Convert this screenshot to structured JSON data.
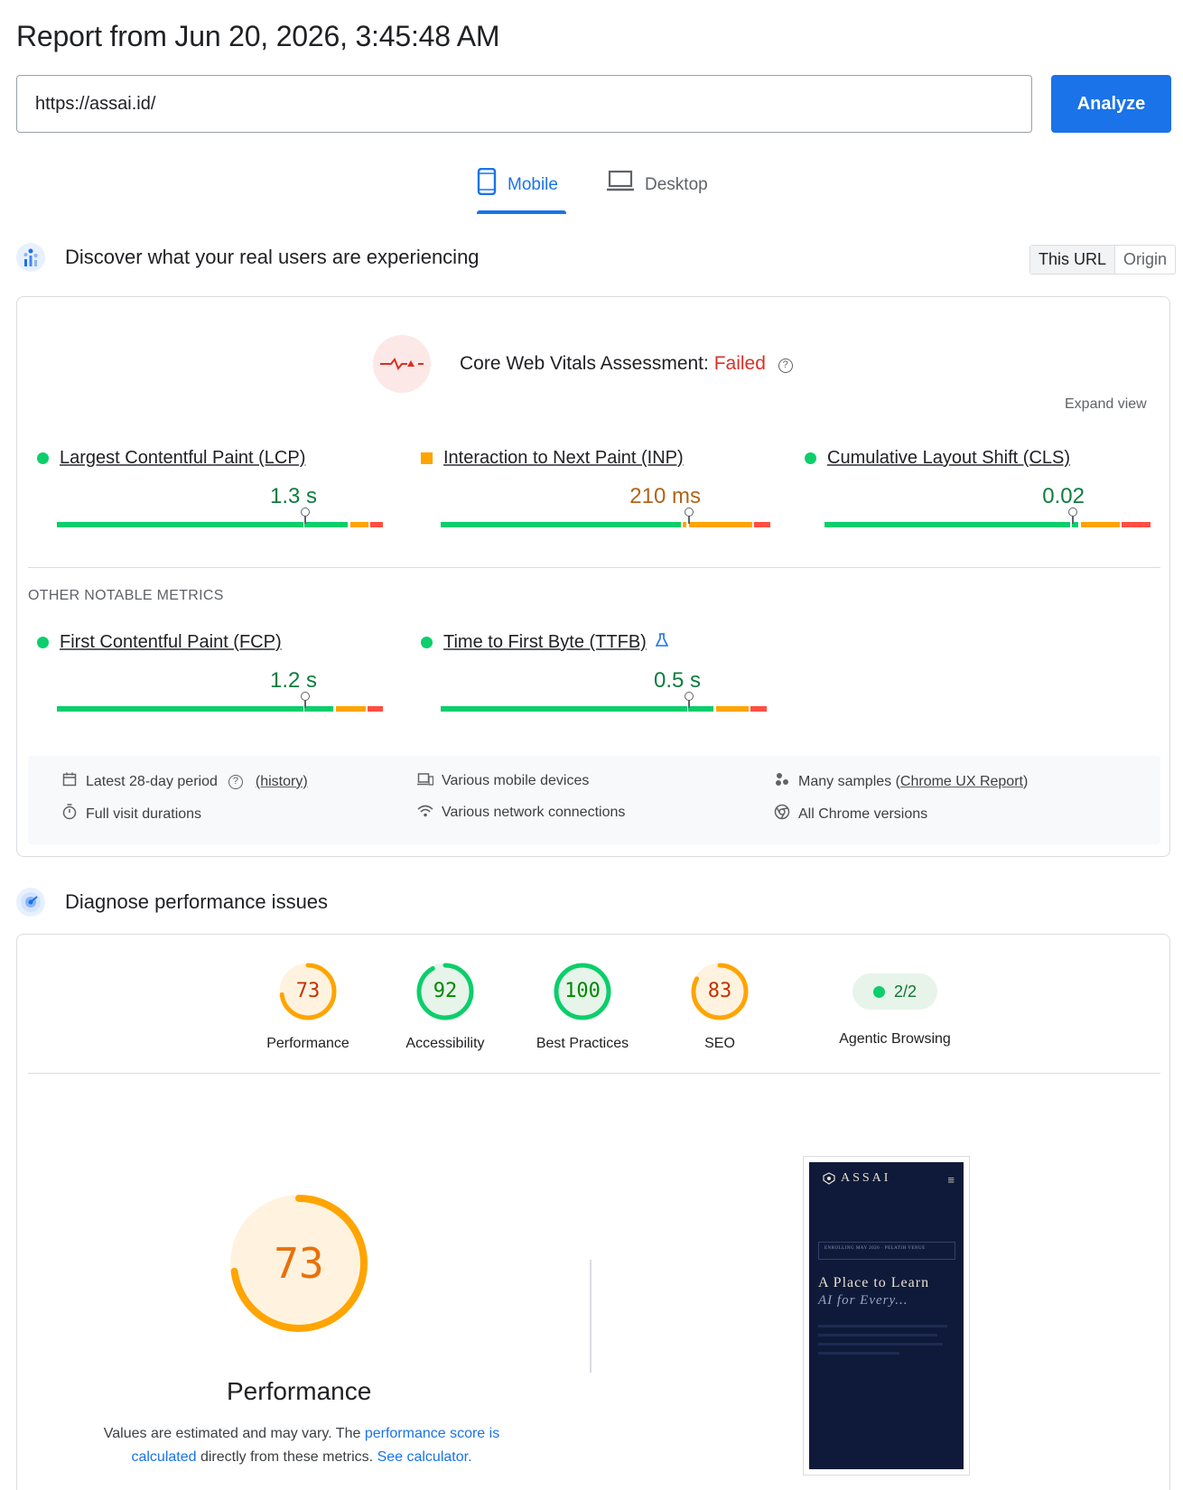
{
  "report_title": "Report from Jun 20, 2026, 3:45:48 AM",
  "url_input": {
    "value": "https://assai.id/"
  },
  "analyze_label": "Analyze",
  "device_tabs": [
    {
      "label": "Mobile",
      "icon": "phone-icon",
      "active": true
    },
    {
      "label": "Desktop",
      "icon": "laptop-icon",
      "active": false
    }
  ],
  "field_section": {
    "title": "Discover what your real users are experiencing",
    "toggle": [
      "This URL",
      "Origin"
    ],
    "assessment_label": "Core Web Vitals Assessment:",
    "assessment_status": "Failed",
    "expand_view": "Expand view",
    "core_metrics": [
      {
        "name": "Largest Contentful Paint (LCP)",
        "value": "1.3 s",
        "rating": "good"
      },
      {
        "name": "Interaction to Next Paint (INP)",
        "value": "210 ms",
        "rating": "needs-improvement"
      },
      {
        "name": "Cumulative Layout Shift (CLS)",
        "value": "0.02",
        "rating": "good"
      }
    ],
    "other_label": "OTHER NOTABLE METRICS",
    "other_metrics": [
      {
        "name": "First Contentful Paint (FCP)",
        "value": "1.2 s",
        "rating": "good"
      },
      {
        "name": "Time to First Byte (TTFB)",
        "value": "0.5 s",
        "rating": "good",
        "icon": "flask-icon"
      }
    ],
    "info": {
      "period": "Latest 28-day period",
      "history": "(history)",
      "durations": "Full visit durations",
      "devices": "Various mobile devices",
      "network": "Various network connections",
      "samples_prefix": "Many samples (",
      "samples_link": "Chrome UX Report",
      "samples_suffix": ")",
      "versions": "All Chrome versions"
    }
  },
  "lab_section": {
    "title": "Diagnose performance issues",
    "scores": [
      {
        "label": "Performance",
        "score": "73",
        "fraction": 0.73,
        "color": "#ffa400",
        "text_color": "#c33300"
      },
      {
        "label": "Accessibility",
        "score": "92",
        "fraction": 0.92,
        "color": "#0cce6b",
        "text_color": "#008800"
      },
      {
        "label": "Best Practices",
        "score": "100",
        "fraction": 1.0,
        "color": "#0cce6b",
        "text_color": "#008800"
      },
      {
        "label": "SEO",
        "score": "83",
        "fraction": 0.83,
        "color": "#ffa400",
        "text_color": "#c33300"
      }
    ],
    "agentic": {
      "label": "Agentic Browsing",
      "value": "2/2"
    },
    "big_score": {
      "score": "73",
      "fraction": 0.73,
      "label": "Performance"
    },
    "note": {
      "before": "Values are estimated and may vary. The ",
      "link1": "performance score is calculated",
      "middle": " directly from these metrics. ",
      "link2": "See calculator."
    },
    "screenshot": {
      "brand": "ASSAI",
      "tag": "ENROLLING MAY 2026 · PELATIH VENUE",
      "headline_1": "A Place to Learn",
      "headline_2": "AI for Every..."
    }
  },
  "colors": {
    "good": "#0cce6b",
    "average": "#ffa400",
    "poor": "#ff4e42",
    "accent": "#1a73e8"
  }
}
